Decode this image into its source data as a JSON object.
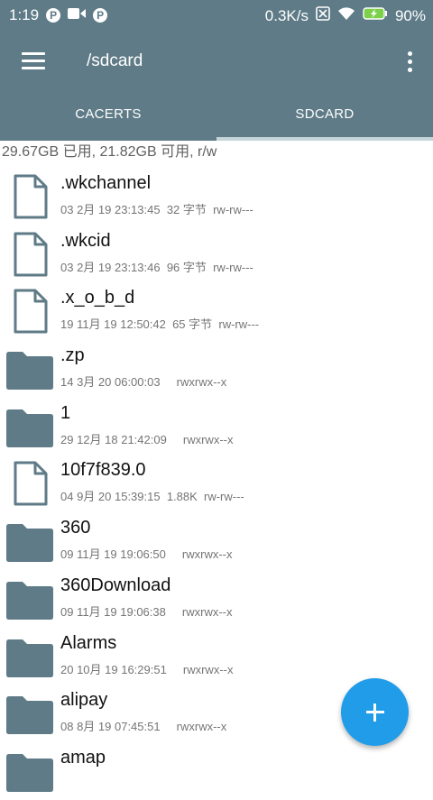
{
  "status": {
    "time": "1:19",
    "net_speed": "0.3K/s",
    "battery": "90%"
  },
  "appbar": {
    "title": "/sdcard"
  },
  "tabs": [
    {
      "label": "CACERTS",
      "selected": false
    },
    {
      "label": "SDCARD",
      "selected": true
    }
  ],
  "storage_info": "29.67GB 已用, 21.82GB 可用, r/w",
  "files": [
    {
      "name": ".wkchannel",
      "type": "file",
      "meta": "03 2月 19 23:13:45  32 字节  rw-rw---"
    },
    {
      "name": ".wkcid",
      "type": "file",
      "meta": "03 2月 19 23:13:46  96 字节  rw-rw---"
    },
    {
      "name": ".x_o_b_d",
      "type": "file",
      "meta": "19 11月 19 12:50:42  65 字节  rw-rw---"
    },
    {
      "name": ".zp",
      "type": "folder",
      "meta": "14 3月 20 06:00:03     rwxrwx--x"
    },
    {
      "name": "1",
      "type": "folder",
      "meta": "29 12月 18 21:42:09     rwxrwx--x"
    },
    {
      "name": "10f7f839.0",
      "type": "file",
      "meta": "04 9月 20 15:39:15  1.88K  rw-rw---"
    },
    {
      "name": "360",
      "type": "folder",
      "meta": "09 11月 19 19:06:50     rwxrwx--x"
    },
    {
      "name": "360Download",
      "type": "folder",
      "meta": "09 11月 19 19:06:38     rwxrwx--x"
    },
    {
      "name": "Alarms",
      "type": "folder",
      "meta": "20 10月 19 16:29:51     rwxrwx--x"
    },
    {
      "name": "alipay",
      "type": "folder",
      "meta": "08 8月 19 07:45:51     rwxrwx--x"
    },
    {
      "name": "amap",
      "type": "folder",
      "meta": ""
    }
  ],
  "colors": {
    "primary": "#5e7b87",
    "accent": "#209ce9",
    "icon": "#5e7b87"
  }
}
